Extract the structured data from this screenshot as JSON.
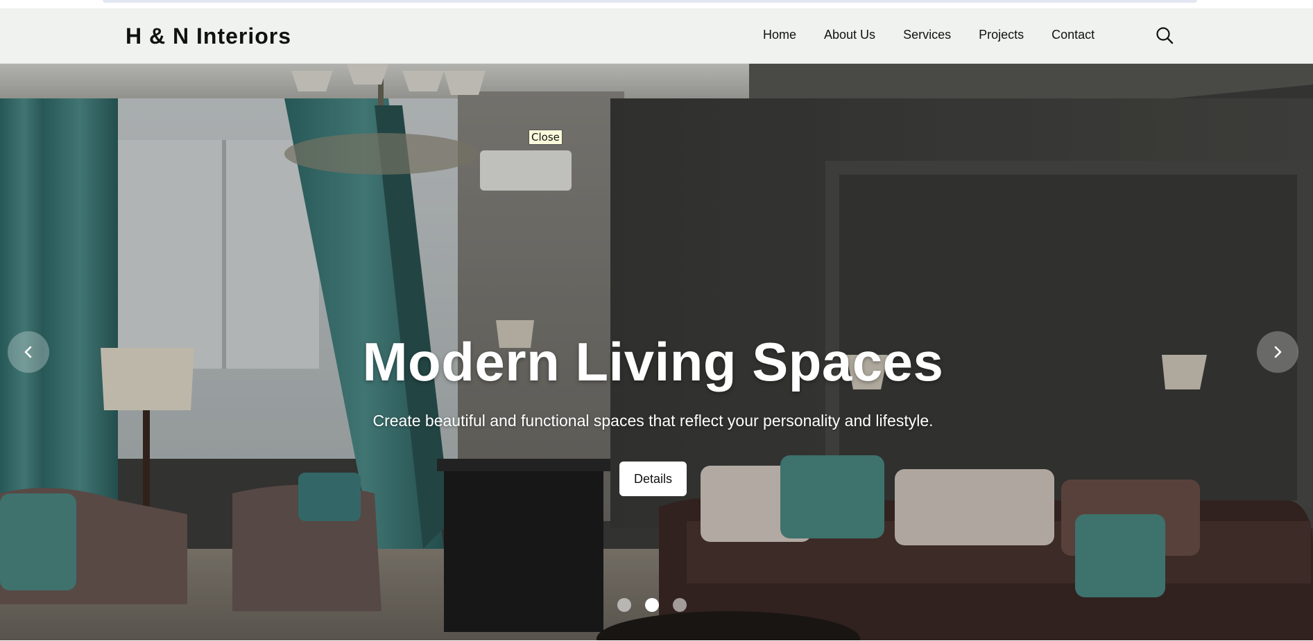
{
  "site": {
    "logo": "H & N Interiors"
  },
  "nav": {
    "items": [
      "Home",
      "About Us",
      "Services",
      "Projects",
      "Contact"
    ],
    "search_icon": "search-icon"
  },
  "tooltip": {
    "text": "Close"
  },
  "hero": {
    "title": "Modern Living Spaces",
    "subtitle": "Create beautiful and functional spaces that reflect your personality and lifestyle.",
    "button_label": "Details",
    "prev_icon": "chevron-left-icon",
    "next_icon": "chevron-right-icon",
    "slide_count": 3,
    "active_slide": 2
  },
  "colors": {
    "header_bg": "#eff2ee",
    "button_bg": "#ffffff",
    "text_dark": "#111111"
  }
}
